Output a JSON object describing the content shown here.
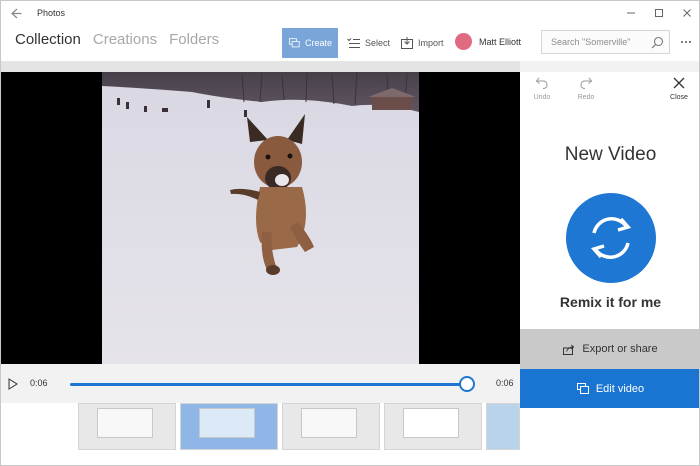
{
  "window": {
    "app_title": "Photos",
    "back_icon": "back-arrow-icon",
    "controls": [
      "minimize-icon",
      "maximize-icon",
      "close-icon"
    ]
  },
  "nav": {
    "tabs": [
      {
        "label": "Collection",
        "active": true
      },
      {
        "label": "Creations",
        "active": false
      },
      {
        "label": "Folders",
        "active": false
      }
    ]
  },
  "commands": {
    "create": {
      "label": "Create",
      "icon": "create-icon"
    },
    "select": {
      "label": "Select",
      "icon": "select-icon"
    },
    "import": {
      "label": "Import",
      "icon": "import-icon"
    }
  },
  "user": {
    "name": "Matt Elliott",
    "avatar_color": "#e06a7f"
  },
  "search": {
    "placeholder": "Search \"Somerville\"",
    "icon": "search-icon"
  },
  "more": {
    "icon": "more-icon"
  },
  "player": {
    "current_time": "0:06",
    "end_time": "0:06",
    "progress": 1.0,
    "play_icon": "play-icon"
  },
  "panel": {
    "undo_label": "Undo",
    "redo_label": "Redo",
    "close_label": "Close",
    "title": "New Video",
    "remix_label": "Remix it for me",
    "export_label": "Export or share",
    "edit_label": "Edit video"
  },
  "colors": {
    "accent": "#1e77d2",
    "create_button": "#7aa5d9",
    "export_button": "#c9c9c9"
  }
}
